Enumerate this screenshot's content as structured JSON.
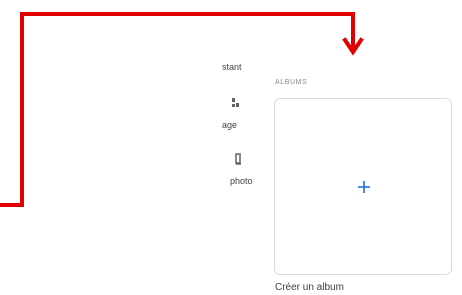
{
  "menu": {
    "item1_label": "stant",
    "item2_label": "age",
    "item3_label": "photo"
  },
  "albums": {
    "heading": "ALBUMS",
    "create_label": "Créer un album"
  },
  "icons": {
    "plus": "plus-icon",
    "menu_item2": "image-icon",
    "menu_item3": "photo-icon"
  },
  "colors": {
    "annotation_red": "#e00000",
    "accent_blue": "#1a73e8",
    "border": "#dadce0",
    "muted_text": "#80868b"
  }
}
